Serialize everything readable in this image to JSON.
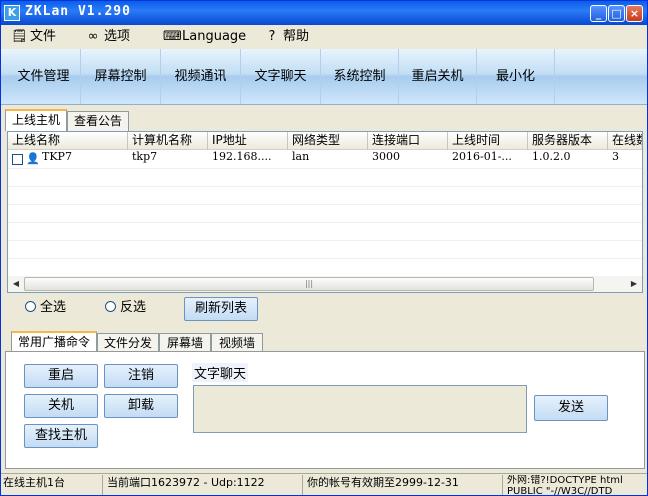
{
  "window": {
    "icon_letter": "K",
    "title": "ZKLan V1.290",
    "controls": {
      "minimize": "_",
      "maximize": "□",
      "close": "×"
    }
  },
  "menu": {
    "items": [
      {
        "label": "文件",
        "icon": "notepad-icon"
      },
      {
        "label": "选项",
        "icon": "glasses-icon"
      },
      {
        "label": "Language",
        "icon": "language-icon"
      },
      {
        "label": "帮助",
        "icon": "help-icon"
      }
    ]
  },
  "toolbar": {
    "buttons": [
      "文件管理",
      "屏幕控制",
      "视频通讯",
      "文字聊天",
      "系统控制",
      "重启关机",
      "最小化"
    ]
  },
  "host_tabs": [
    "上线主机",
    "查看公告"
  ],
  "grid": {
    "columns": [
      "上线名称",
      "计算机名称",
      "IP地址",
      "网络类型",
      "连接端口",
      "上线时间",
      "服务器版本",
      "在线数"
    ],
    "rows": [
      [
        "TKP7",
        "tkp7",
        "192.168....",
        "lan",
        "3000",
        "2016-01-...",
        "1.0.2.0",
        "3"
      ]
    ],
    "scroll_grip": "|||"
  },
  "controls": {
    "select_all": "全选",
    "invert_select": "反选",
    "refresh_list": "刷新列表"
  },
  "command_tabs": [
    "常用广播命令",
    "文件分发",
    "屏幕墙",
    "视频墙"
  ],
  "commands": {
    "restart": "重启",
    "logoff": "注销",
    "shutdown": "关机",
    "uninstall": "卸载",
    "find_host": "查找主机",
    "chat_label": "文字聊天",
    "send": "发送"
  },
  "status": {
    "online": "在线主机1台",
    "port": "当前端口1623972 - Udp:1122",
    "expiry": "你的帐号有效期至2999-12-31",
    "wan_line1": "外网:错?!DOCTYPE html",
    "wan_line2": "PUBLIC \"-//W3C//DTD"
  }
}
